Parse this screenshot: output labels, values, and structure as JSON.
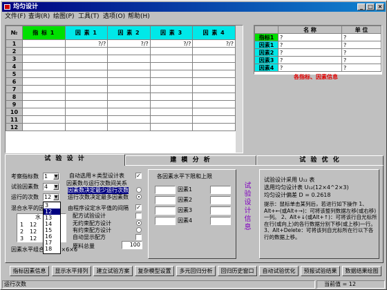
{
  "window": {
    "title": "均匀设计",
    "controls": [
      "_",
      "□",
      "×"
    ]
  },
  "menu": [
    "文件(F)",
    "查询(R)",
    "绘图(P)",
    "工具(T)",
    "选项(O)",
    "帮助(H)"
  ],
  "design_table": {
    "corner": "№",
    "headers": [
      "指 标 1",
      "因 素 1",
      "因 素 2",
      "因 素 3",
      "因 素 4"
    ],
    "row_numbers": [
      "1",
      "2",
      "3",
      "4",
      "5",
      "6",
      "7",
      "8",
      "9",
      "10",
      "11",
      "12"
    ],
    "row1": [
      "",
      "?/?",
      "?/?",
      "?/?",
      "?/?"
    ]
  },
  "info_table": {
    "headers": [
      "",
      "名 称",
      "单 位"
    ],
    "rows": [
      [
        "指标1",
        "?",
        "?"
      ],
      [
        "因素1",
        "?",
        "?"
      ],
      [
        "因素2",
        "?",
        "?"
      ],
      [
        "因素3",
        "?",
        "?"
      ],
      [
        "因素4",
        "?",
        "?"
      ]
    ],
    "caption": "各指标、因素信息"
  },
  "tabs": [
    "试 验 设 计",
    "建 模 分 析",
    "试 验 优 化"
  ],
  "settings": {
    "num_indicators_label": "考察指标数",
    "num_indicators": "1",
    "num_factors_label": "试验因素数",
    "num_factors": "4",
    "num_runs_label": "运行的次数",
    "num_runs": "12",
    "mixed_levels_label": "混合水平的因",
    "level_col_header": "水",
    "level_rows": [
      [
        "1",
        "12"
      ],
      [
        "2",
        "12"
      ],
      [
        "3",
        "12"
      ]
    ],
    "level_group_label": "因素水平组合 12×6×6×6"
  },
  "dropdown": {
    "items": [
      "3",
      "12",
      "13",
      "14",
      "15",
      "16",
      "17",
      "18",
      "19"
    ],
    "selected": "12"
  },
  "options": {
    "auto_type": "自动选用＊类型设计表",
    "relation_group": "因素数与运行次数间关系",
    "opt1": "因素数决定最少运行次数",
    "opt2": "运行次数决定最多因素数",
    "level_interval": "由程序设定水平值的间隔",
    "mix_design": "配方试验设计",
    "no_limit": "无约束配方设计",
    "with_limit": "有约束配方设计",
    "auto_show": "自动显示配方",
    "total_label": "原料总量",
    "total_value": "100"
  },
  "bounds": {
    "title": "各因素水平下限和上限",
    "factors": [
      "因素1",
      "因素2",
      "因素3",
      "因素4"
    ]
  },
  "vertical_label": "试验设计信息",
  "design_info": {
    "line1": "试验设计采用 U₁₂ 表",
    "line2": "选用均匀设计表 U₁₂(12×4^2×3)",
    "line3": "均匀设计偏差 D = 0.2618",
    "tip": "提示：鼠标单击某列后，若进行如下操作 1、Alt+←(或Alt+→)：可将该整列数据左移(或右移)一列。 2、Alt+↓(或Alt+↑)：可将该行自光标所在行(或向上)的各行数据分别下移(或上移)一行。 3、Alt+Delete：可将该列自光标所在行以下各行的数据上移。"
  },
  "buttons": [
    "指标因素信息",
    "显示水平排列",
    "建立试验方案",
    "复杂模型设置",
    "多元回归分析",
    "回归历史窗口",
    "自动试验优化",
    "预报试验结果",
    "数据结果绘图"
  ],
  "status": {
    "left": "运行次数",
    "right": "当前值 = 12"
  }
}
